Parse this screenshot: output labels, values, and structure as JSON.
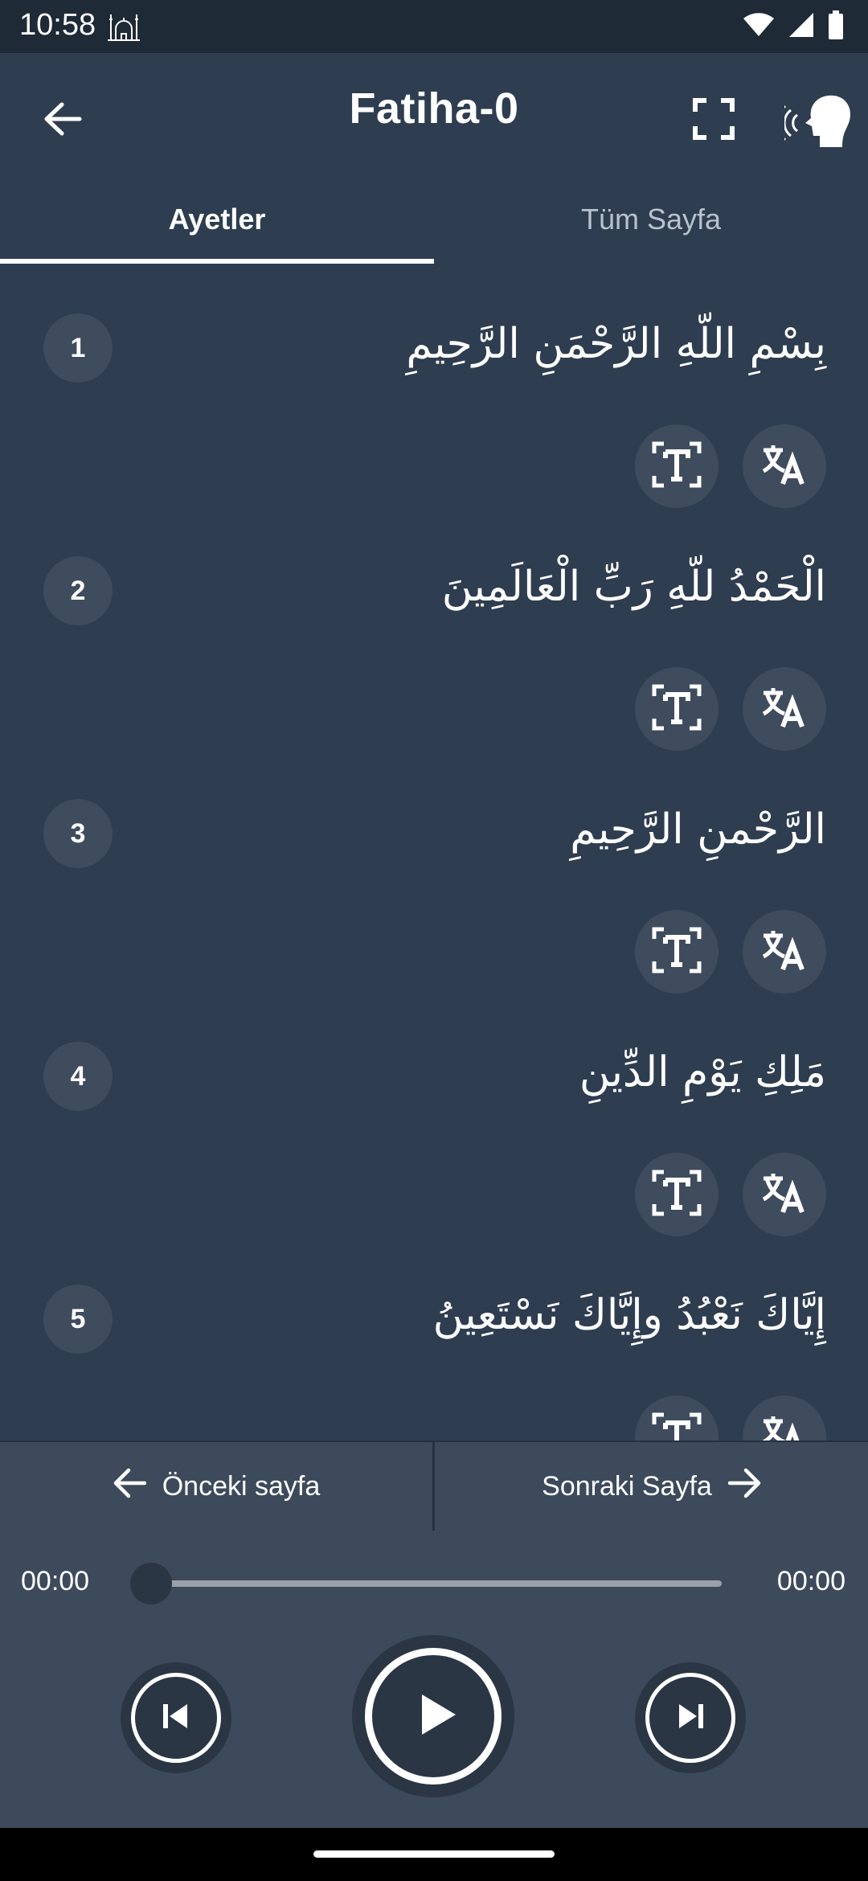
{
  "status_bar": {
    "time": "10:58"
  },
  "app_bar": {
    "title": "Fatiha-0"
  },
  "tabs": [
    {
      "label": "Ayetler",
      "selected": true
    },
    {
      "label": "Tüm Sayfa",
      "selected": false
    }
  ],
  "verses": [
    {
      "number": "1",
      "text": "بِسْمِ اللّهِ الرَّحْمَنِ الرَّحِيمِ"
    },
    {
      "number": "2",
      "text": "الْحَمْدُ للّهِ رَبِّ الْعَالَمِينَ"
    },
    {
      "number": "3",
      "text": "الرَّحْمنِ الرَّحِيمِ"
    },
    {
      "number": "4",
      "text": "مَلِكِ يَوْمِ الدِّينِ"
    },
    {
      "number": "5",
      "text": "إِيَّاكَ نَعْبُدُ وإِيَّاكَ نَسْتَعِينُ"
    }
  ],
  "navigation": {
    "prev_label": "Önceki sayfa",
    "next_label": "Sonraki Sayfa"
  },
  "player": {
    "current_time": "00:00",
    "total_time": "00:00",
    "progress": 0
  },
  "colors": {
    "background": "#2e3d50",
    "panel": "#3d4a5b",
    "button": "#3e4c5d",
    "status_bar": "#1f2a37"
  }
}
